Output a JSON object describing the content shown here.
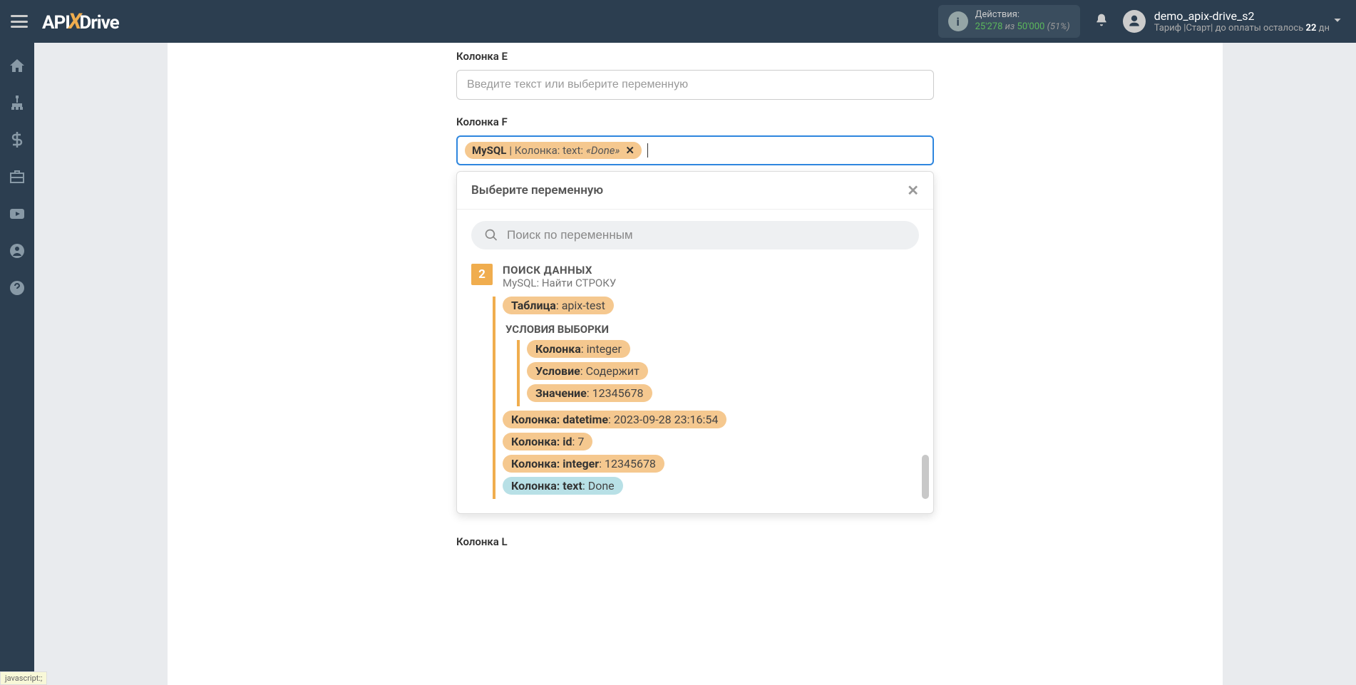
{
  "header": {
    "logo_pre": "API",
    "logo_x": "X",
    "logo_post": "Drive",
    "actions_label": "Действия:",
    "actions_used": "25'278",
    "actions_of": "из",
    "actions_total": "50'000",
    "actions_pct": "(51%)",
    "user_name": "demo_apix-drive_s2",
    "tariff_pre": "Тариф |Старт| до оплаты осталось ",
    "tariff_days": "22",
    "tariff_post": " дн"
  },
  "fields": {
    "e_label": "Колонка E",
    "e_placeholder": "Введите текст или выберите переменную",
    "f_label": "Колонка F",
    "f_chip_source": "MySQL",
    "f_chip_sep": " | Колонка: text: ",
    "f_chip_val": "«Done»",
    "l_label": "Колонка L"
  },
  "dropdown": {
    "title": "Выберите переменную",
    "search_placeholder": "Поиск по переменным",
    "badge": "2",
    "section_title": "ПОИСК ДАННЫХ",
    "section_sub": "MySQL: Найти СТРОКУ",
    "tag_table_k": "Таблица",
    "tag_table_v": ": apix-test",
    "cond_title": "УСЛОВИЯ ВЫБОРКИ",
    "cond_col_k": "Колонка",
    "cond_col_v": ": integer",
    "cond_op_k": "Условие",
    "cond_op_v": ": Содержит",
    "cond_val_k": "Значение",
    "cond_val_v": ": 12345678",
    "row_dt_k": "Колонка: datetime",
    "row_dt_v": ": 2023-09-28 23:16:54",
    "row_id_k": "Колонка: id",
    "row_id_v": ": 7",
    "row_int_k": "Колонка: integer",
    "row_int_v": ": 12345678",
    "row_txt_k": "Колонка: text",
    "row_txt_v": ": Done"
  },
  "status": "javascript:;"
}
